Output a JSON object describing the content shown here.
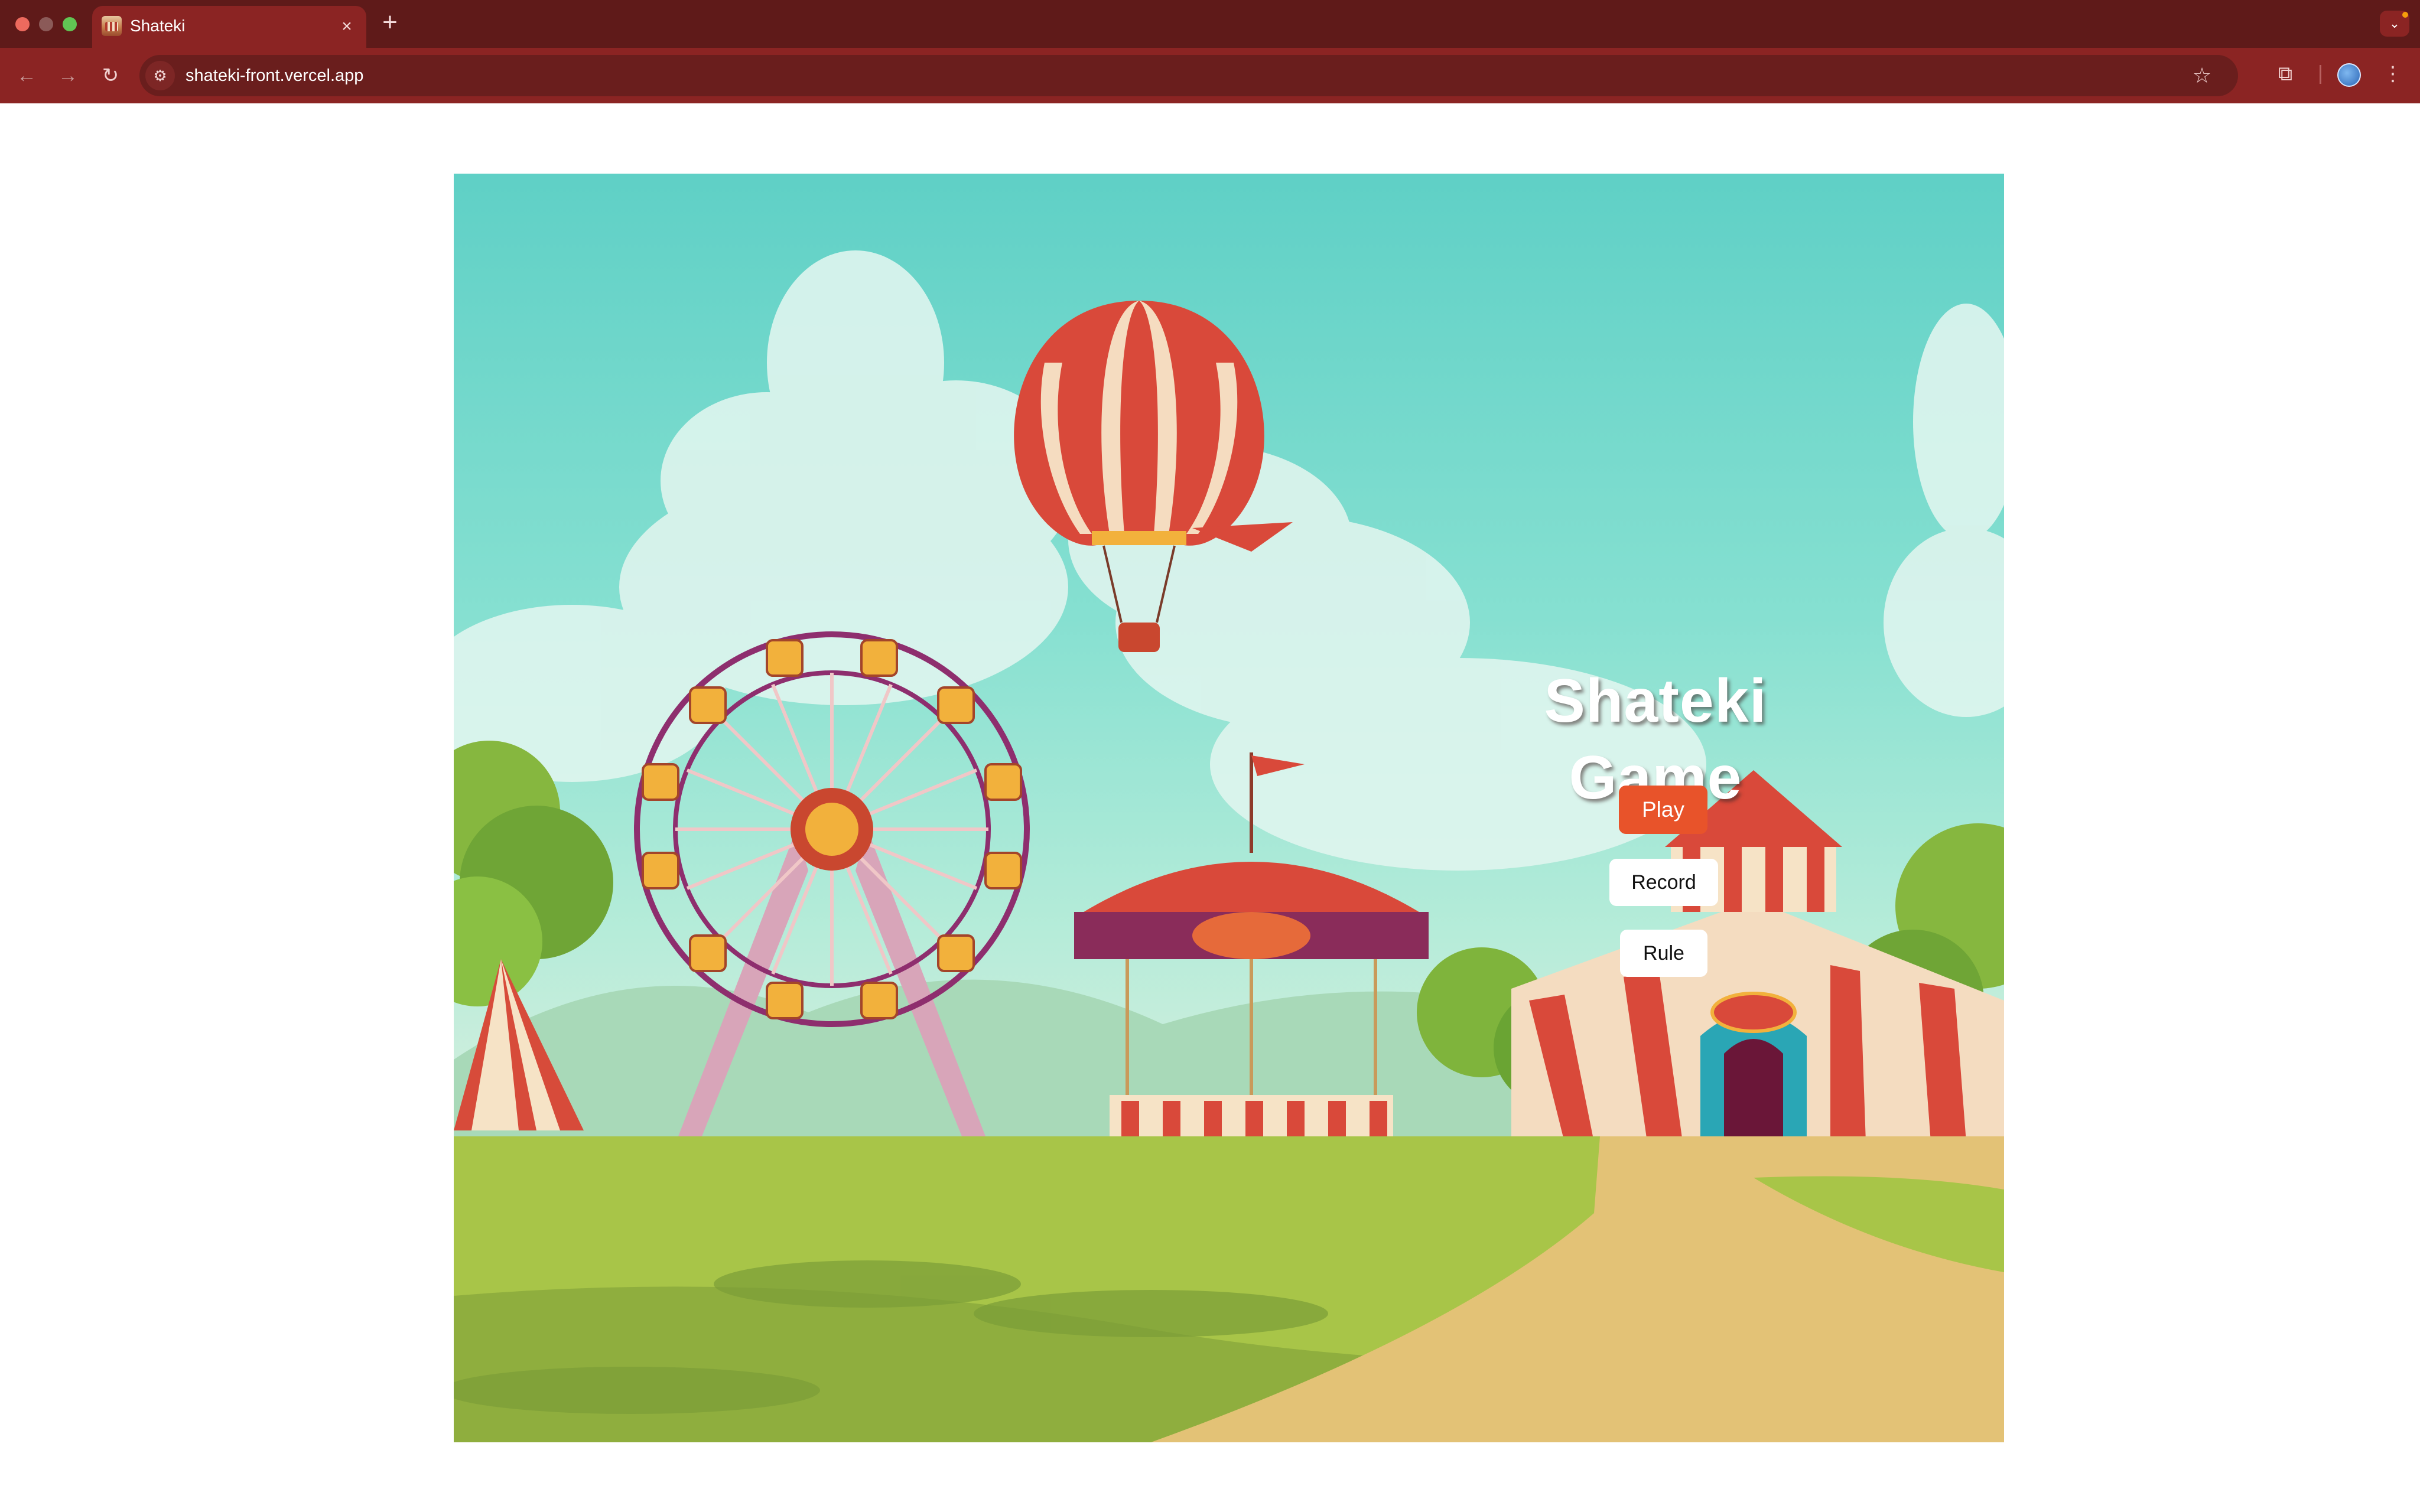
{
  "browser": {
    "tab_title": "Shateki",
    "url": "shateki-front.vercel.app",
    "icons": {
      "back": "arrow-left-icon",
      "forward": "arrow-right-icon",
      "reload": "reload-icon",
      "site_info": "tune-icon",
      "bookmark": "star-icon",
      "extensions": "puzzle-icon",
      "menu": "kebab-menu-icon",
      "tab_search": "chevron-down-icon",
      "new_tab": "plus-icon",
      "close_tab": "close-icon"
    },
    "colors": {
      "tabbar": "#5f1a19",
      "toolbar": "#8b2423",
      "omnibox": "#6a1e1d"
    }
  },
  "game": {
    "title": "Shateki Game",
    "buttons": {
      "play": "Play",
      "record": "Record",
      "rule": "Rule"
    },
    "colors": {
      "play_button": "#e8532a",
      "secondary_button": "#ffffff"
    }
  }
}
